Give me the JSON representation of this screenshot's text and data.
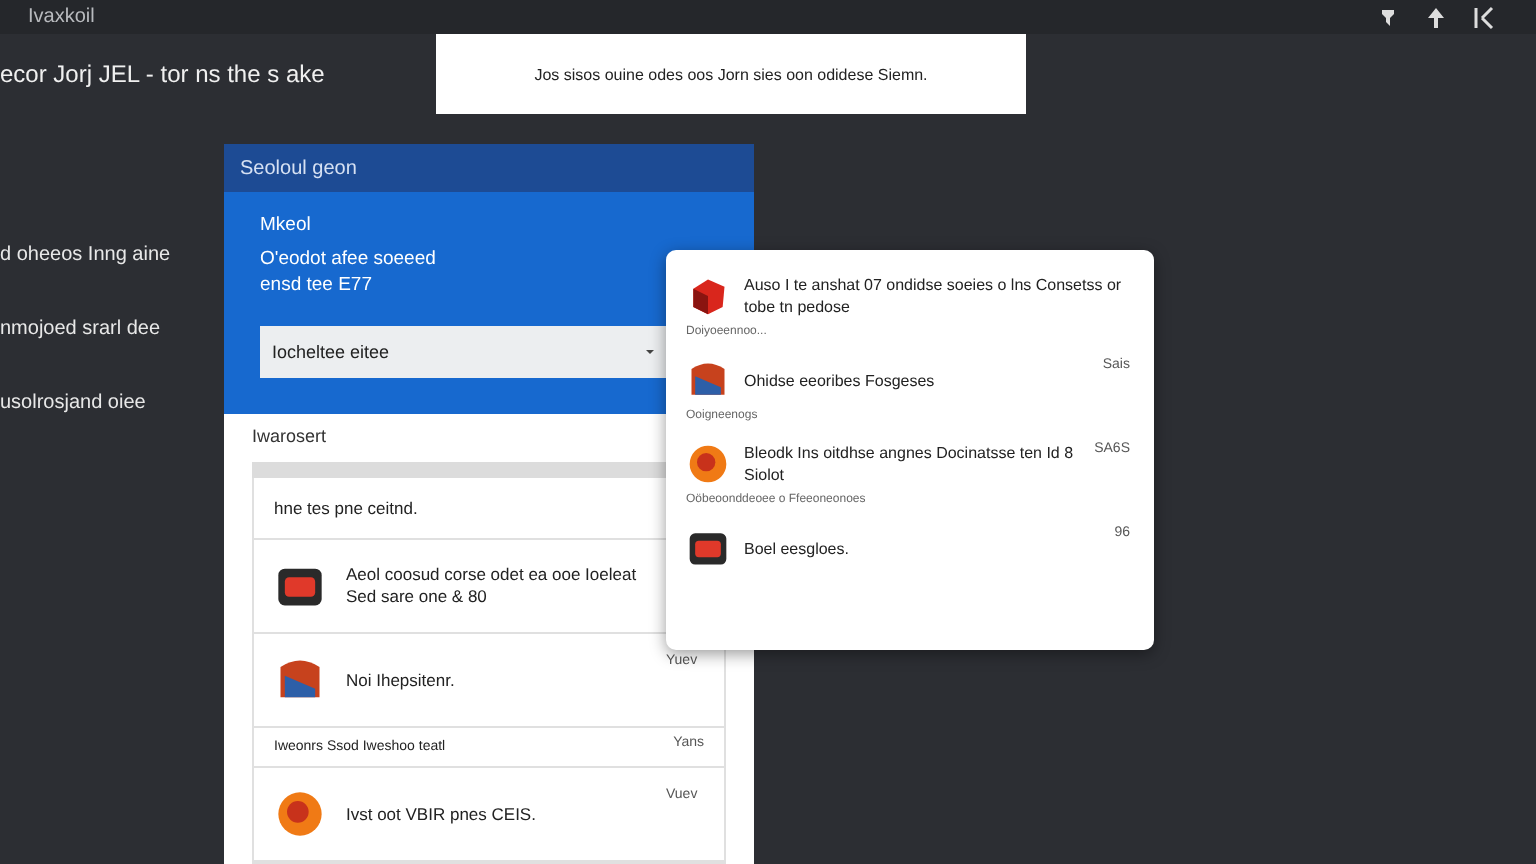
{
  "window": {
    "title": "Ivaxkoil"
  },
  "headline": {
    "text": "ecor Jorj JEL - tor ns the s ake",
    "notice": "Jos sisos ouine odes oos Jorn sies oon odidese Siemn."
  },
  "side_links": [
    "d oheeos Inng aine",
    "nmojoed srarl dee",
    "usolrosjand oiee"
  ],
  "panel": {
    "title": "Seoloul geon",
    "label": "Mkeol",
    "lines": [
      "O'eodot afee soeeed",
      "ensd tee E77"
    ],
    "select": {
      "value": "Iocheltee eitee"
    },
    "section_title": "Iwarosert",
    "note": "hne tes pne ceitnd.",
    "rows": [
      {
        "kind": "item",
        "text": "Aeol coosud corse odet ea ooe Ioeleat Sed sare one & 80"
      },
      {
        "kind": "item",
        "text": "Noi Ihepsitenr.",
        "time": "Yuev"
      },
      {
        "kind": "caption",
        "text": "Iweonrs Ssod Iweshoo teatl",
        "time": "Yans"
      },
      {
        "kind": "item",
        "text": "Ivst oot VBIR pnes CEIS.",
        "time": "Vuev"
      }
    ]
  },
  "popup": {
    "items": [
      {
        "text": "Auso I te anshat 07 ondidse soeies o lns Consetss or tobe tn pedose",
        "caption": "Doiyoeennoo..."
      },
      {
        "text": "Ohidse eeoribes Fosgeses",
        "time": "Sais",
        "caption": "Ooigneenogs"
      },
      {
        "text": "Bleodk Ins oitdhse angnes Docinatsse ten Id 8 Siolot",
        "time": "SA6S",
        "caption": "Oöbeoonddeoee o Ffeeoneonoes"
      },
      {
        "text": "Boel eesgloes.",
        "time": "96"
      }
    ]
  }
}
